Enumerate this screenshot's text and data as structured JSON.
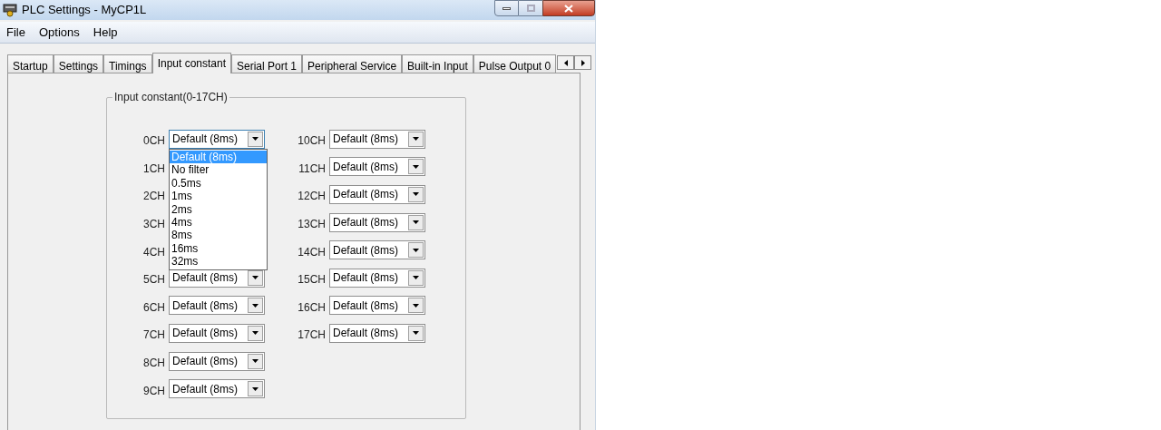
{
  "window": {
    "title": "PLC Settings - MyCP1L"
  },
  "menu": [
    "File",
    "Options",
    "Help"
  ],
  "tabs": [
    {
      "label": "Startup",
      "selected": false
    },
    {
      "label": "Settings",
      "selected": false
    },
    {
      "label": "Timings",
      "selected": false
    },
    {
      "label": "Input constant",
      "selected": true
    },
    {
      "label": "Serial Port 1",
      "selected": false
    },
    {
      "label": "Peripheral Service",
      "selected": false
    },
    {
      "label": "Built-in Input",
      "selected": false
    },
    {
      "label": "Pulse Output 0",
      "selected": false
    }
  ],
  "group": {
    "title": "Input constant(0-17CH)",
    "columns": [
      [
        {
          "label": "0CH",
          "value": "Default (8ms)",
          "expanded": true
        },
        {
          "label": "1CH"
        },
        {
          "label": "2CH"
        },
        {
          "label": "3CH"
        },
        {
          "label": "4CH"
        },
        {
          "label": "5CH",
          "value": "Default (8ms)",
          "expanded": false
        },
        {
          "label": "6CH",
          "value": "Default (8ms)",
          "expanded": false
        },
        {
          "label": "7CH",
          "value": "Default (8ms)",
          "expanded": false
        },
        {
          "label": "8CH",
          "value": "Default (8ms)",
          "expanded": false
        },
        {
          "label": "9CH",
          "value": "Default (8ms)",
          "expanded": false
        }
      ],
      [
        {
          "label": "10CH",
          "value": "Default (8ms)",
          "expanded": false
        },
        {
          "label": "11CH",
          "value": "Default (8ms)",
          "expanded": false
        },
        {
          "label": "12CH",
          "value": "Default (8ms)",
          "expanded": false
        },
        {
          "label": "13CH",
          "value": "Default (8ms)",
          "expanded": false
        },
        {
          "label": "14CH",
          "value": "Default (8ms)",
          "expanded": false
        },
        {
          "label": "15CH",
          "value": "Default (8ms)",
          "expanded": false
        },
        {
          "label": "16CH",
          "value": "Default (8ms)",
          "expanded": false
        },
        {
          "label": "17CH",
          "value": "Default (8ms)",
          "expanded": false
        }
      ]
    ]
  },
  "dropdown_options": [
    {
      "label": "Default (8ms)",
      "selected": true
    },
    {
      "label": "No filter",
      "selected": false
    },
    {
      "label": "0.5ms",
      "selected": false
    },
    {
      "label": "1ms",
      "selected": false
    },
    {
      "label": "2ms",
      "selected": false
    },
    {
      "label": "4ms",
      "selected": false
    },
    {
      "label": "8ms",
      "selected": false
    },
    {
      "label": "16ms",
      "selected": false
    },
    {
      "label": "32ms",
      "selected": false
    }
  ]
}
